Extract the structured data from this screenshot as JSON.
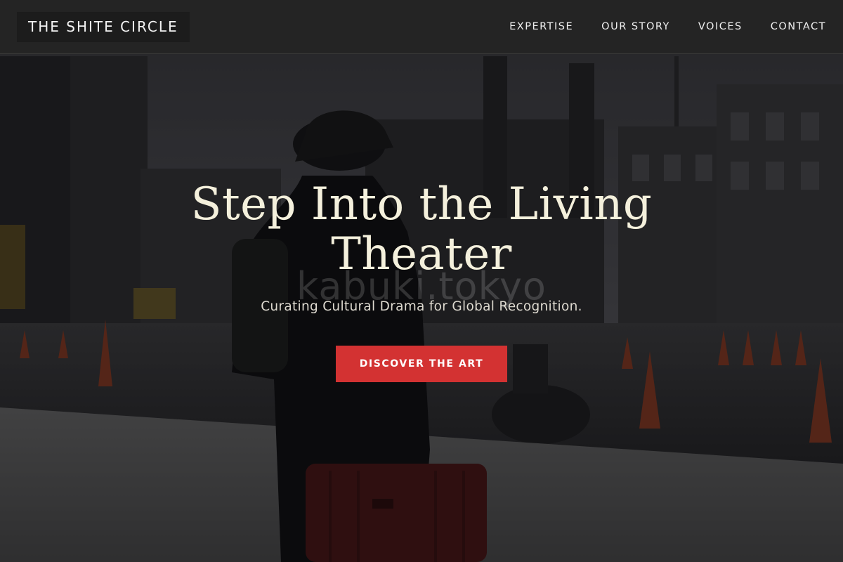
{
  "navbar": {
    "brand": "THE SHITE CIRCLE",
    "links": [
      {
        "label": "EXPERTISE"
      },
      {
        "label": "OUR STORY"
      },
      {
        "label": "VOICES"
      },
      {
        "label": "CONTACT"
      }
    ]
  },
  "hero": {
    "title_line1": "Step Into the Living",
    "title_line2": "Theater",
    "watermark": "kabuki.tokyo",
    "subtitle": "Curating Cultural Drama for Global Recognition.",
    "cta_label": "DISCOVER THE ART"
  },
  "colors": {
    "accent": "#d33232",
    "title": "#f4f0dc",
    "navbar_bg": "#242424"
  }
}
